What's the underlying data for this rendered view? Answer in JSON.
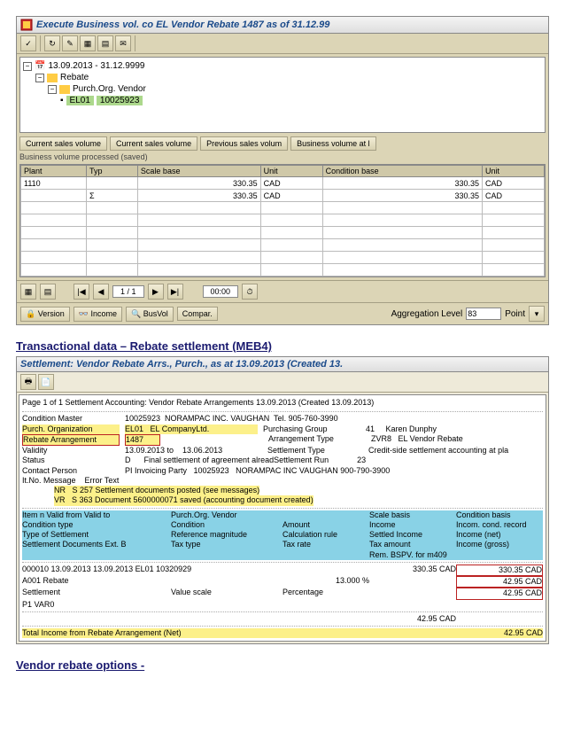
{
  "app1": {
    "title": "Execute Business vol. co EL Vendor Rebate 1487 as of 31.12.99",
    "tree": {
      "root": "13.09.2013 - 31.12.9999",
      "lvl1": "Rebate",
      "lvl2": "Purch.Org. Vendor",
      "lvl3_code": "EL01",
      "lvl3_num": "10025923"
    },
    "tabs": [
      "Current sales volume",
      "Current sales volume",
      "Previous sales volum",
      "Business volume at l"
    ],
    "sub": "Business volume processed (saved)",
    "grid": {
      "headers": [
        "Plant",
        "Typ",
        "Scale base",
        "Unit",
        "Condition base",
        "Unit"
      ],
      "rows": [
        [
          "1110",
          "",
          "330.35",
          "CAD",
          "330.35",
          "CAD"
        ],
        [
          "",
          "Σ",
          "330.35",
          "CAD",
          "330.35",
          "CAD"
        ]
      ]
    },
    "bot": {
      "version": "Version",
      "income": "Income",
      "busvol": "BusVol",
      "compar": "Compar.",
      "page": "1 / 1",
      "timer": "00:00",
      "agg_lbl": "Aggregation Level",
      "agg_val": "83",
      "agg_unit": "Point"
    }
  },
  "section1": "Transactional data – Rebate settlement (MEB4)",
  "app2": {
    "title": "Settlement: Vendor Rebate Arrs., Purch., as at 13.09.2013 (Created 13.",
    "page": "Page     1  of     1  Settlement Accounting: Vendor Rebate Arrangements 13.09.2013 (Created 13.09.2013)",
    "hdr": {
      "cond_master_l": "Condition Master",
      "cond_master_v": "10025923  NORAMPAC INC. VAUGHAN  Tel. 905-760-3990",
      "purch_org_l": "Purch. Organization",
      "purch_org_v": "EL01   EL CompanyLtd.",
      "purch_grp_l": "Purchasing Group",
      "purch_grp_v": "41     Karen Dunphy",
      "arr_l": "Rebate Arrangement",
      "arr_v": "1487",
      "arr_type_l": "Arrangement Type",
      "arr_type_v": "ZVR8   EL Vendor Rebate",
      "valid_l": "Validity",
      "valid_v": "13.09.2013 to    13.06.2013",
      "stl_type_l": "Settlement Type",
      "stl_type_v": "Credit-side settlement accounting at pla",
      "status_l": "Status",
      "status_v": "D      Final settlement of agreement alreadSettlement Run",
      "run": "23",
      "contact_l": "Contact Person",
      "contact_v": "PI Invoicing Party   10025923   NORAMPAC INC VAUGHAN 900-790-3900",
      "itno": "It.No. Message    Error Text",
      "msg1": "NR   S 257 Settlement documents posted (see messages)",
      "msg2": "VR   S 363 Document 5600000071 saved (accounting document created)"
    },
    "cols": {
      "c1": "Item n Valid from Valid to",
      "c2": "Purch.Org. Vendor",
      "c3": "",
      "c4": "Scale basis",
      "c5": "Condition basis",
      "r2c1": "Condition type",
      "r2c2": "Condition",
      "r2c3": "Amount",
      "r2c4": "Income",
      "r2c5": "Incom. cond. record",
      "r3c1": "Type of Settlement",
      "r3c2": "Reference magnitude",
      "r3c3": "Calculation rule",
      "r3c4": "Settled Income",
      "r3c5": "Income (net)",
      "r4c1": "Settlement Documents  Ext. B",
      "r4c2": "Tax type",
      "r4c3": "Tax rate",
      "r4c4": "Tax amount",
      "r4c5": "Income (gross)",
      "r5c4": "Rem. BSPV. for m409"
    },
    "data": {
      "line1": "000010 13.09.2013 13.09.2013  EL01     10320929",
      "line1_sb": "330.35 CAD",
      "line1_cb": "330.35 CAD",
      "line2": "A001 Rebate",
      "line2_amt": "13.000 %",
      "line2_inc": "42.95 CAD",
      "line3": "Settlement",
      "line3_b": "Value scale",
      "line3_c": "Percentage",
      "line3_d": "42.95 CAD",
      "line4": "P1              VAR0",
      "sum": "42.95 CAD",
      "total_l": "Total Income from Rebate Arrangement (Net)",
      "total_v": "42.95 CAD"
    }
  },
  "section2": "Vendor rebate options -"
}
